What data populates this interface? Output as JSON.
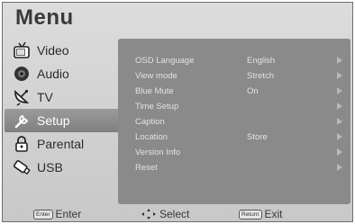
{
  "menu": {
    "title": "Menu"
  },
  "sidebar": {
    "items": [
      {
        "label": "Video",
        "icon": "tv-icon"
      },
      {
        "label": "Audio",
        "icon": "speaker-icon"
      },
      {
        "label": "TV",
        "icon": "satellite-dish-icon"
      },
      {
        "label": "Setup",
        "icon": "wrench-icon",
        "selected": true
      },
      {
        "label": "Parental",
        "icon": "lock-icon"
      },
      {
        "label": "USB",
        "icon": "usb-icon"
      }
    ]
  },
  "setup": {
    "rows": [
      {
        "label": "OSD Language",
        "value": "English"
      },
      {
        "label": "View mode",
        "value": "Stretch"
      },
      {
        "label": "Blue Mute",
        "value": "On"
      },
      {
        "label": "Time Setup",
        "value": ""
      },
      {
        "label": "Caption",
        "value": ""
      },
      {
        "label": "Location",
        "value": "Store"
      },
      {
        "label": "Version Info",
        "value": ""
      },
      {
        "label": "Reset",
        "value": ""
      }
    ]
  },
  "footer": {
    "enter_key": "Enter",
    "enter_label": "Enter",
    "select_label": "Select",
    "return_key": "Return",
    "return_label": "Exit"
  },
  "colors": {
    "frame_bg": "#d2d2d2",
    "panel_bg": "#8a8a8a",
    "selected_bg": "#8c8c8c",
    "title_text": "#3a3a3a"
  }
}
